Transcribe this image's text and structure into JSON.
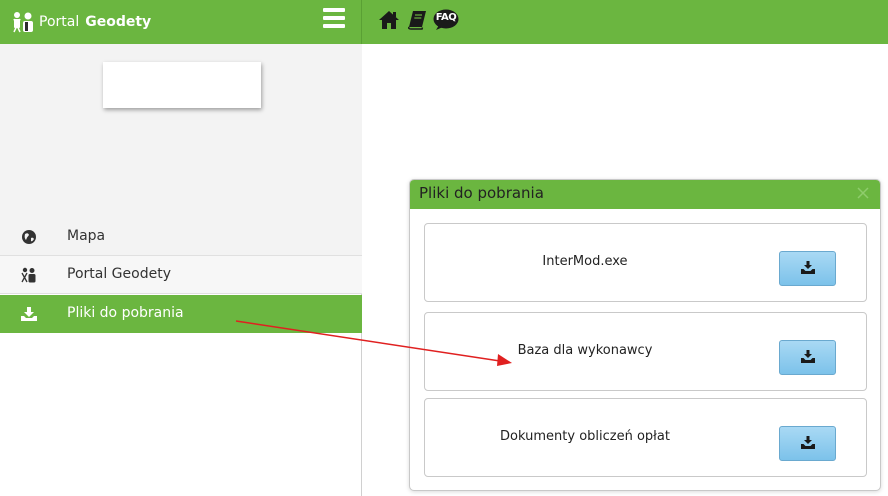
{
  "brand": {
    "part1": "Portal",
    "part2": "Geodety"
  },
  "sidebar": {
    "items": [
      {
        "label": "Mapa",
        "icon": "globe-icon"
      },
      {
        "label": "Portal Geodety",
        "icon": "surveyor-icon"
      },
      {
        "label": "Pliki do pobrania",
        "icon": "download-icon",
        "active": true
      }
    ]
  },
  "topbar": {
    "icons": [
      "home-icon",
      "book-icon",
      "faq-icon"
    ],
    "faq_label": "FAQ"
  },
  "dialog": {
    "title": "Pliki do pobrania",
    "close_symbol": "×",
    "files": [
      {
        "name": "InterMod.exe"
      },
      {
        "name": "Baza dla wykonawcy"
      },
      {
        "name": "Dokumenty obliczeń opłat"
      }
    ]
  },
  "colors": {
    "brand_green": "#6bb640",
    "button_blue": "#8ccbef",
    "arrow_red": "#e02020"
  }
}
